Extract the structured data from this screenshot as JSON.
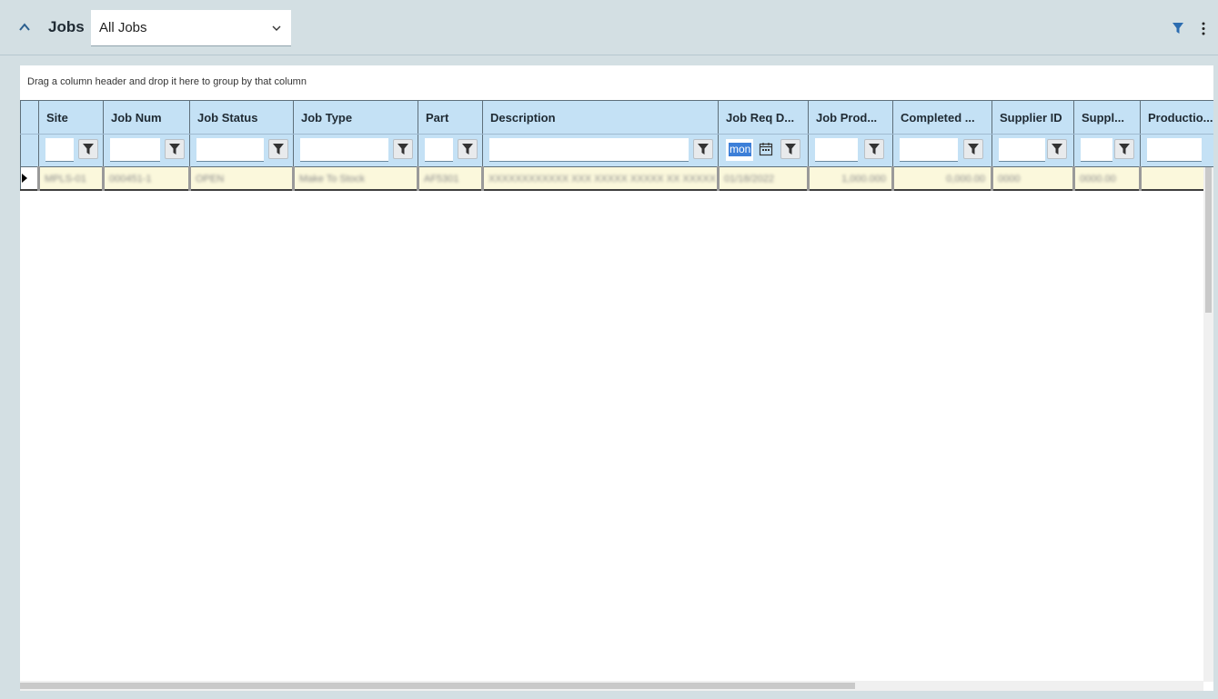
{
  "header": {
    "title": "Jobs",
    "view_selected": "All Jobs"
  },
  "grid": {
    "group_hint": "Drag a column header and drop it here to group by that column",
    "columns": [
      {
        "key": "site",
        "label": "Site"
      },
      {
        "key": "job_num",
        "label": "Job Num"
      },
      {
        "key": "job_status",
        "label": "Job Status"
      },
      {
        "key": "job_type",
        "label": "Job Type"
      },
      {
        "key": "part",
        "label": "Part"
      },
      {
        "key": "description",
        "label": "Description"
      },
      {
        "key": "job_req_date",
        "label": "Job Req D..."
      },
      {
        "key": "job_prod",
        "label": "Job Prod..."
      },
      {
        "key": "completed",
        "label": "Completed ..."
      },
      {
        "key": "supplier_id",
        "label": "Supplier ID"
      },
      {
        "key": "suppl",
        "label": "Suppl..."
      },
      {
        "key": "production",
        "label": "Productio..."
      }
    ],
    "date_filter_text": "mon",
    "rows": [
      {
        "site": "MPLS-01",
        "job_num": "000451-1",
        "job_status": "OPEN",
        "job_type": "Make To Stock",
        "part": "AF5301",
        "description": "XXXXXXXXXXXX XXX XXXXX XXXXX XX XXXXX ...",
        "job_req_date": "01/18/2022",
        "job_prod": "1,000.000",
        "completed": "0,000.00",
        "supplier_id": "0000",
        "suppl": "0000.00",
        "production": ""
      }
    ]
  },
  "icons": {
    "collapse": "chevron-up-icon",
    "dropdown": "chevron-down-icon",
    "filter": "filter-icon",
    "more": "more-vertical-icon",
    "calendar": "calendar-icon",
    "row_indicator": "row-indicator-icon"
  }
}
